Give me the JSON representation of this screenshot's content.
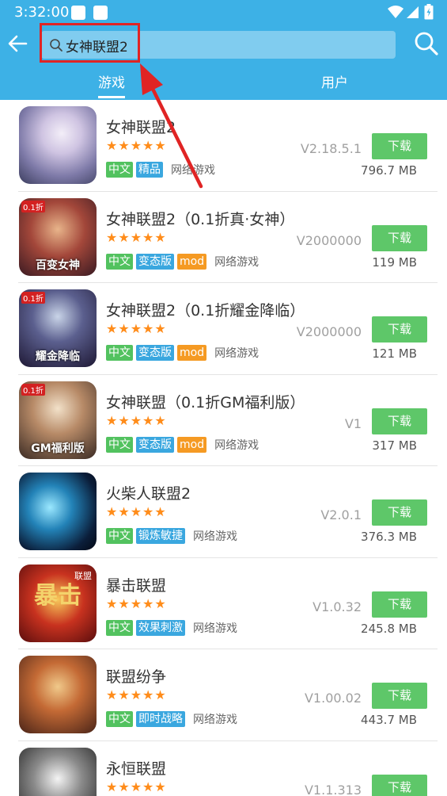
{
  "status_bar": {
    "time": "3:32:00"
  },
  "search": {
    "query": "女神联盟2"
  },
  "tabs": [
    {
      "label": "游戏"
    },
    {
      "label": "用户"
    }
  ],
  "colors": {
    "header": "#3db1e6",
    "download": "#5ec769",
    "star": "#ff8c1a",
    "tag_green": "#52c25f",
    "tag_blue": "#3aa7df",
    "tag_orange": "#f59a23",
    "annotation": "#e02424"
  },
  "results": [
    {
      "name": "女神联盟2",
      "stars": "★★★★★",
      "rating": 5,
      "tags": [
        "中文",
        "精品"
      ],
      "category": "网络游戏",
      "version": "V2.18.5.1",
      "download": "下载",
      "size": "796.7 MB"
    },
    {
      "name": "女神联盟2（0.1折真·女神）",
      "stars": "★★★★★",
      "rating": 5,
      "tags": [
        "中文",
        "变态版",
        "mod"
      ],
      "category": "网络游戏",
      "version": "V2000000",
      "download": "下载",
      "size": "119 MB"
    },
    {
      "name": "女神联盟2（0.1折耀金降临）",
      "stars": "★★★★★",
      "rating": 5,
      "tags": [
        "中文",
        "变态版",
        "mod"
      ],
      "category": "网络游戏",
      "version": "V2000000",
      "download": "下载",
      "size": "121 MB"
    },
    {
      "name": "女神联盟（0.1折GM福利版）",
      "stars": "★★★★★",
      "rating": 5,
      "tags": [
        "中文",
        "变态版",
        "mod"
      ],
      "category": "网络游戏",
      "version": "V1",
      "download": "下载",
      "size": "317 MB"
    },
    {
      "name": "火柴人联盟2",
      "stars": "★★★★★",
      "rating": 5,
      "tags": [
        "中文",
        "锻炼敏捷"
      ],
      "category": "网络游戏",
      "version": "V2.0.1",
      "download": "下载",
      "size": "376.3 MB"
    },
    {
      "name": "暴击联盟",
      "stars": "★★★★★",
      "rating": 5,
      "tags": [
        "中文",
        "效果刺激"
      ],
      "category": "网络游戏",
      "version": "V1.0.32",
      "download": "下载",
      "size": "245.8 MB"
    },
    {
      "name": "联盟纷争",
      "stars": "★★★★★",
      "rating": 5,
      "tags": [
        "中文",
        "即时战略"
      ],
      "category": "网络游戏",
      "version": "V1.00.02",
      "download": "下载",
      "size": "443.7 MB"
    },
    {
      "name": "永恒联盟",
      "stars": "★★★★★",
      "rating": 5,
      "tags": [],
      "category": "",
      "version": "V1.1.313",
      "download": "下载",
      "size": ""
    }
  ],
  "icon_art": {
    "1": [
      "0.1折",
      "百变女神"
    ],
    "2": [
      "0.1折",
      "耀金降临"
    ],
    "3": [
      "0.1折",
      "GM福利版"
    ],
    "5": [
      "暴击",
      "联盟"
    ]
  }
}
